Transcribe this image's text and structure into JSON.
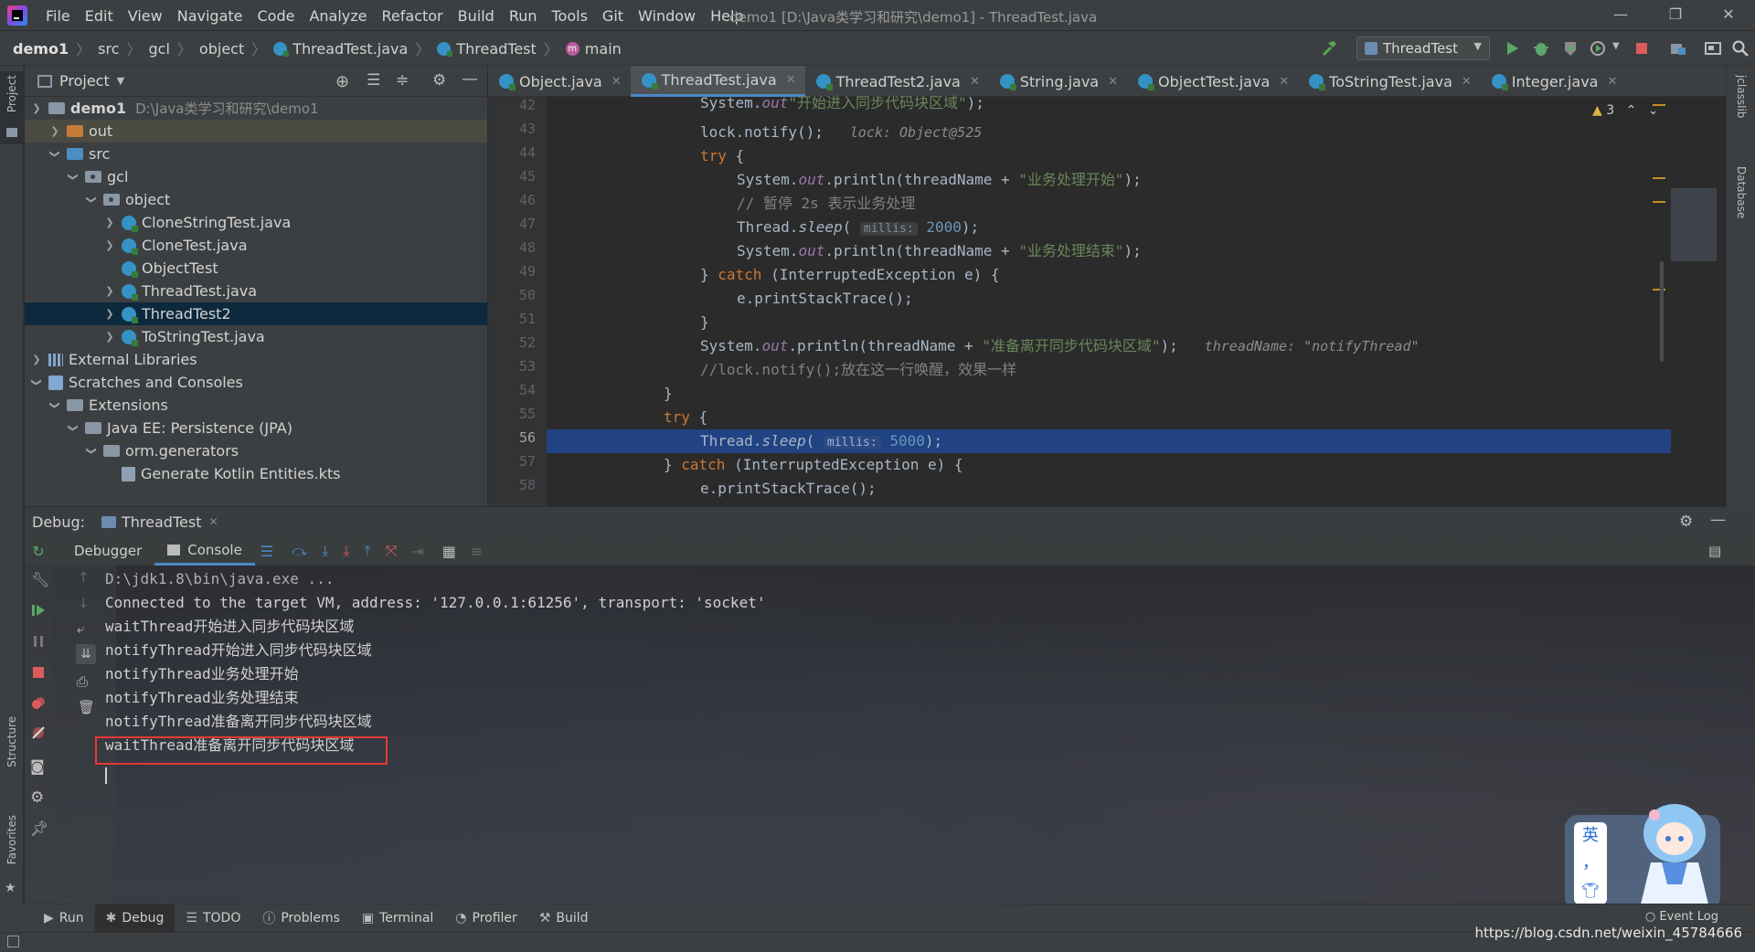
{
  "menu": {
    "items": [
      "File",
      "Edit",
      "View",
      "Navigate",
      "Code",
      "Analyze",
      "Refactor",
      "Build",
      "Run",
      "Tools",
      "Git",
      "Window",
      "Help"
    ],
    "title": "demo1 [D:\\Java类学习和研究\\demo1] - ThreadTest.java"
  },
  "breadcrumb": [
    "demo1",
    "src",
    "gcl",
    "object",
    "ThreadTest.java",
    "ThreadTest",
    "main"
  ],
  "run_config": "ThreadTest",
  "sidebar": {
    "project_tab": "Project",
    "structure_tab": "Structure",
    "favorites_tab": "Favorites"
  },
  "project": {
    "title": "Project",
    "rows": [
      {
        "label": "demo1",
        "extra": "D:\\Java类学习和研究\\demo1"
      },
      {
        "label": "out"
      },
      {
        "label": "src"
      },
      {
        "label": "gcl"
      },
      {
        "label": "object"
      },
      {
        "label": "CloneStringTest.java"
      },
      {
        "label": "CloneTest.java"
      },
      {
        "label": "ObjectTest"
      },
      {
        "label": "ThreadTest.java"
      },
      {
        "label": "ThreadTest2"
      },
      {
        "label": "ToStringTest.java"
      },
      {
        "label": "External Libraries"
      },
      {
        "label": "Scratches and Consoles"
      },
      {
        "label": "Extensions"
      },
      {
        "label": "Java EE: Persistence (JPA)"
      },
      {
        "label": "orm.generators"
      },
      {
        "label": "Generate Kotlin Entities.kts"
      }
    ]
  },
  "tabs": [
    "Object.java",
    "ThreadTest.java",
    "ThreadTest2.java",
    "String.java",
    "ObjectTest.java",
    "ToStringTest.java",
    "Integer.java"
  ],
  "editor": {
    "warnings": "3",
    "line_numbers": [
      "42",
      "43",
      "44",
      "45",
      "46",
      "47",
      "48",
      "49",
      "50",
      "51",
      "52",
      "53",
      "54",
      "55",
      "56",
      "57",
      "58"
    ],
    "lines": {
      "l42": {
        "a": "System.",
        "b": "out",
        ".c": ".println(threadName + ",
        "d": "\"开始进入同步代码块区域\"",
        "e": ");"
      },
      "l43": {
        "a": "lock.notify();",
        "hint": "lock: Object@525"
      },
      "l44": {
        "kw": "try",
        "rest": " {"
      },
      "l45": {
        "a": "System.",
        "b": "out",
        "c": ".println(threadName + ",
        "d": "\"业务处理开始\"",
        "e": ");"
      },
      "l46": {
        "cm": "// 暂停 2s 表示业务处理"
      },
      "l47": {
        "a": "Thread.",
        "m": "sleep",
        "b": "(",
        "hint": "millis:",
        "n": "2000",
        "e": ");"
      },
      "l48": {
        "a": "System.",
        "b": "out",
        "c": ".println(threadName + ",
        "d": "\"业务处理结束\"",
        "e": ");"
      },
      "l49": {
        "a": "} ",
        "kw": "catch",
        "rest": " (InterruptedException e) {"
      },
      "l50": {
        "a": "e.printStackTrace();"
      },
      "l51": {
        "a": "}"
      },
      "l52": {
        "a": "System.",
        "b": "out",
        "c": ".println(threadName + ",
        "d": "\"准备离开同步代码块区域\"",
        "e": ");",
        "hint": "threadName: \"notifyThread\""
      },
      "l53": {
        "cm": "//lock.notify();放在这一行唤醒，效果一样"
      },
      "l54": {
        "a": "}"
      },
      "l55": {
        "kw": "try",
        "rest": " {"
      },
      "l56": {
        "a": "Thread.",
        "m": "sleep",
        "b": "(",
        "hint": "millis:",
        "n": "5000",
        "e": ");"
      },
      "l57": {
        "a": "} ",
        "kw": "catch",
        "rest": " (InterruptedException e) {"
      },
      "l58": {
        "a": "e.printStackTrace();"
      }
    }
  },
  "debug": {
    "label": "Debug:",
    "session": "ThreadTest",
    "tabs": [
      "Debugger",
      "Console"
    ],
    "console": [
      "D:\\jdk1.8\\bin\\java.exe ...",
      "Connected to the target VM, address: '127.0.0.1:61256', transport: 'socket'",
      "waitThread开始进入同步代码块区域",
      "notifyThread开始进入同步代码块区域",
      "notifyThread业务处理开始",
      "notifyThread业务处理结束",
      "notifyThread准备离开同步代码块区域",
      "waitThread准备离开同步代码块区域"
    ]
  },
  "bottom_tools": [
    "Run",
    "Debug",
    "TODO",
    "Problems",
    "Terminal",
    "Profiler",
    "Build"
  ],
  "event_log": "Event Log",
  "watermark": "https://blog.csdn.net/weixin_45784666",
  "ime": {
    "lang": "英",
    "punct": "，"
  },
  "right_tabs": [
    "jclasslib",
    "Database"
  ],
  "colors": {
    "accent": "#4a88c7",
    "current_line": "#214283",
    "highlight_box": "#e53935",
    "keyword": "#cc7832",
    "string": "#6a8759"
  }
}
